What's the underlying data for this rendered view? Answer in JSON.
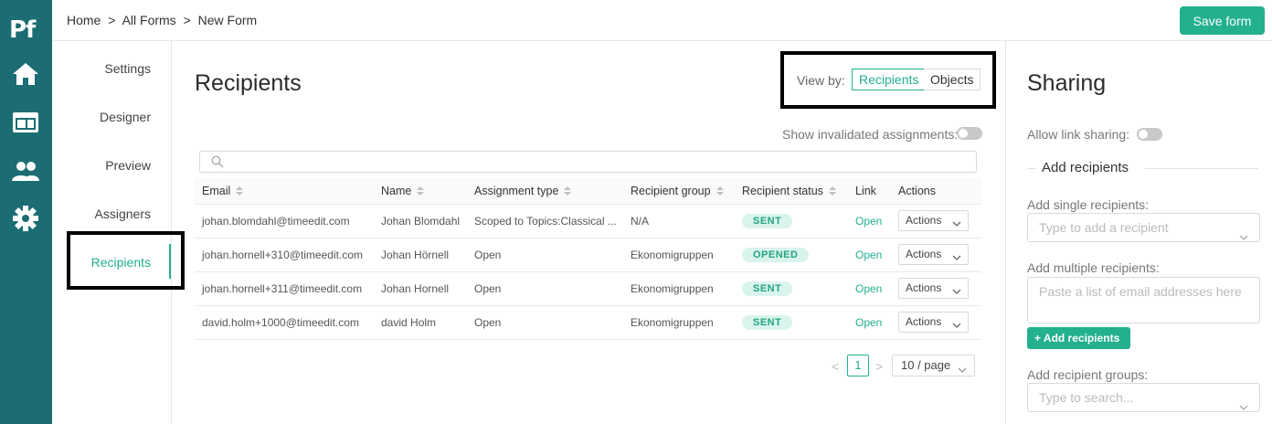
{
  "app": {
    "logo": "Pf"
  },
  "rail": [
    {
      "icon": "home-icon"
    },
    {
      "icon": "forms-icon"
    },
    {
      "icon": "users-icon"
    },
    {
      "icon": "gear-icon"
    }
  ],
  "breadcrumb": [
    "Home",
    ">",
    "All Forms",
    ">",
    "New Form"
  ],
  "toolbar": {
    "save_label": "Save form"
  },
  "subnav": {
    "items": [
      "Settings",
      "Designer",
      "Preview",
      "Assigners",
      "Recipients"
    ],
    "active": "Recipients"
  },
  "main": {
    "title": "Recipients",
    "view_by_label": "View by:",
    "view_by_options": [
      "Recipients",
      "Objects"
    ],
    "view_by_selected": "Recipients",
    "show_invalidated_label": "Show invalidated assignments:",
    "show_invalidated_on": false,
    "search_placeholder": ""
  },
  "table": {
    "columns": [
      "Email",
      "Name",
      "Assignment type",
      "Recipient group",
      "Recipient status",
      "Link",
      "Actions"
    ],
    "rows": [
      {
        "email": "johan.blomdahl@timeedit.com",
        "name": "Johan Blomdahl",
        "assignment_type": "Scoped to Topics:Classical ...",
        "group": "N/A",
        "status": "SENT",
        "link": "Open",
        "actions": "Actions"
      },
      {
        "email": "johan.hornell+310@timeedit.com",
        "name": "Johan Hörnell",
        "assignment_type": "Open",
        "group": "Ekonomigruppen",
        "status": "OPENED",
        "link": "Open",
        "actions": "Actions"
      },
      {
        "email": "johan.hornell+311@timeedit.com",
        "name": "Johan Hornell",
        "assignment_type": "Open",
        "group": "Ekonomigruppen",
        "status": "SENT",
        "link": "Open",
        "actions": "Actions"
      },
      {
        "email": "david.holm+1000@timeedit.com",
        "name": "david Holm",
        "assignment_type": "Open",
        "group": "Ekonomigruppen",
        "status": "SENT",
        "link": "Open",
        "actions": "Actions"
      }
    ]
  },
  "pagination": {
    "prev": "<",
    "next": ">",
    "current": "1",
    "page_size": "10 / page"
  },
  "sharing": {
    "title": "Sharing",
    "allow_link_label": "Allow link sharing:",
    "allow_link_on": false,
    "section_title": "Add recipients",
    "single_label": "Add single recipients:",
    "single_placeholder": "Type to add a recipient",
    "multiple_label": "Add multiple recipients:",
    "multiple_placeholder": "Paste a list of email addresses here",
    "add_button": "+ Add recipients",
    "groups_label": "Add recipient groups:",
    "groups_placeholder": "Type to search..."
  },
  "colors": {
    "rail": "#1b6d73",
    "accent": "#23b08f",
    "badge_bg": "#d9f4ec"
  }
}
